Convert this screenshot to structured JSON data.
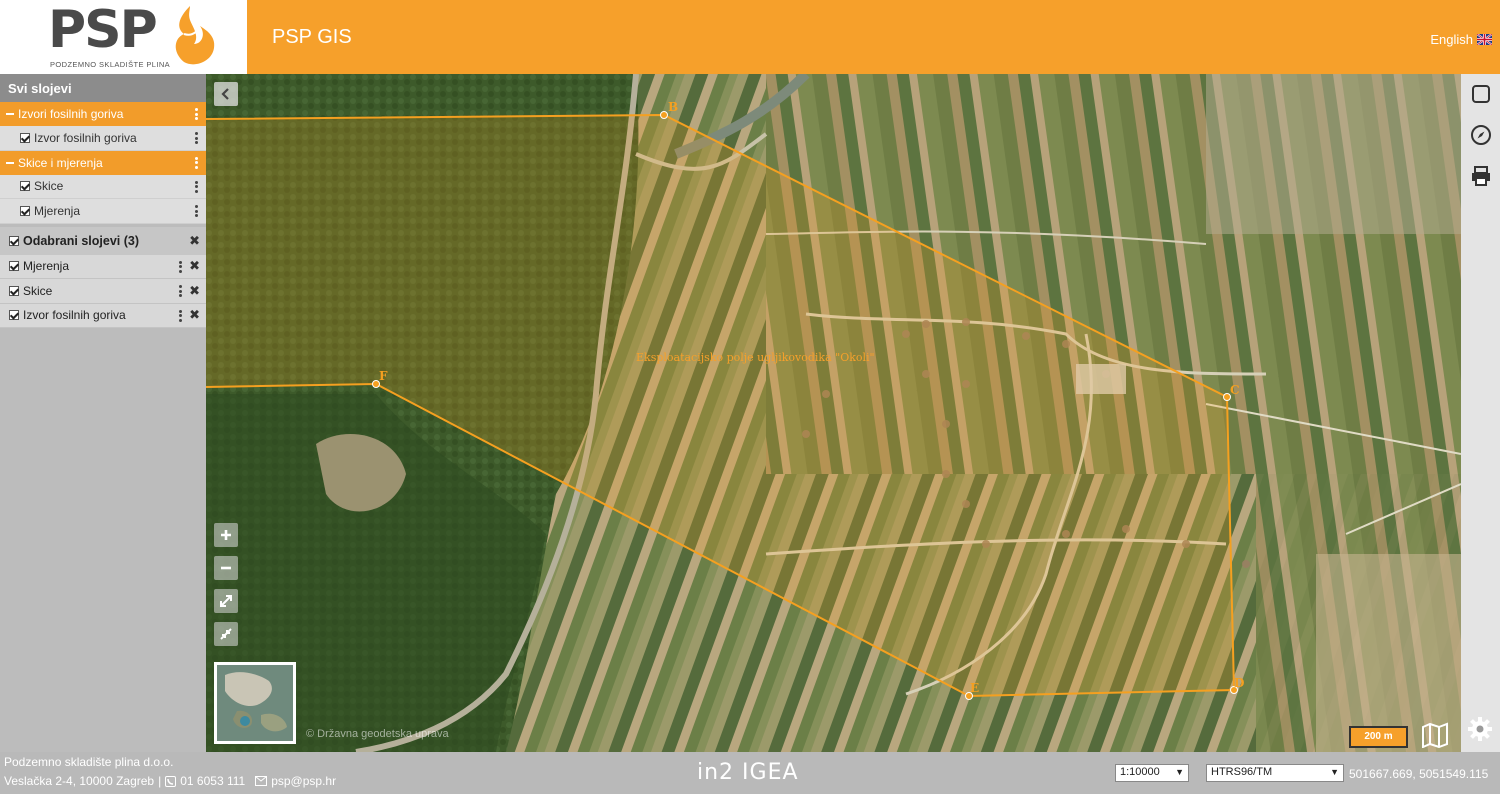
{
  "header": {
    "logo_text": "PSP",
    "logo_subtitle": "PODZEMNO SKLADIŠTE PLINA",
    "app_title": "PSP GIS",
    "language": "English"
  },
  "sidebar": {
    "title": "Svi slojevi",
    "groups": [
      {
        "label": "Izvori fosilnih goriva",
        "layers": [
          {
            "label": "Izvor fosilnih goriva",
            "checked": true
          }
        ]
      },
      {
        "label": "Skice i mjerenja",
        "layers": [
          {
            "label": "Skice",
            "checked": true
          },
          {
            "label": "Mjerenja",
            "checked": true
          }
        ]
      }
    ],
    "selected": {
      "title": "Odabrani slojevi (3)",
      "items": [
        {
          "label": "Mjerenja"
        },
        {
          "label": "Skice"
        },
        {
          "label": "Izvor fosilnih goriva"
        }
      ]
    }
  },
  "map": {
    "polygon_label": "Eksploatacijsko polje ugljikovodika \"Okoli\"",
    "vertices": [
      "B",
      "C",
      "D",
      "E",
      "F"
    ],
    "attribution": "© Državna geodetska uprava",
    "scalebar": "200 m",
    "colors": {
      "accent": "#f6a02b",
      "polygon": "#f5a020"
    }
  },
  "footer": {
    "company": "Podzemno skladište plina d.o.o.",
    "address": "Veslačka 2-4, 10000 Zagreb",
    "phone": "01 6053 111",
    "email": "psp@psp.hr",
    "vendor_logo": "in2 IGEA",
    "scale": "1:10000",
    "crs": "HTRS96/TM",
    "coordinates": "501667.669, 5051549.115"
  }
}
